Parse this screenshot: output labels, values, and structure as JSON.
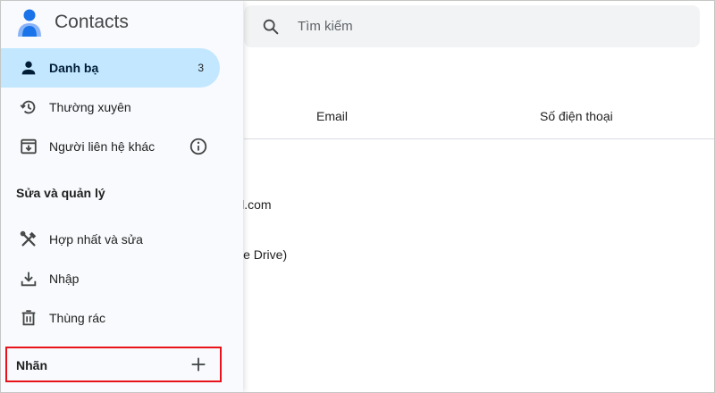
{
  "app": {
    "title": "Contacts"
  },
  "search": {
    "placeholder": "Tìm kiếm",
    "icon": "search-icon"
  },
  "table": {
    "columns": [
      "Email",
      "Số điện thoại"
    ],
    "rows": [
      {
        "fragment": "il.com"
      },
      {
        "fragment": "le Drive)"
      }
    ]
  },
  "sidebar": {
    "items": [
      {
        "label": "Danh bạ",
        "count": "3",
        "icon": "person-icon",
        "active": true
      },
      {
        "label": "Thường xuyên",
        "icon": "history-icon"
      },
      {
        "label": "Người liên hệ khác",
        "icon": "archive-download-icon",
        "info_icon": "info-icon"
      }
    ],
    "section_title": "Sửa và quản lý",
    "manage_items": [
      {
        "label": "Hợp nhất và sửa",
        "icon": "tools-icon"
      },
      {
        "label": "Nhập",
        "icon": "download-icon"
      },
      {
        "label": "Thùng rác",
        "icon": "trash-icon"
      }
    ],
    "labels": {
      "title": "Nhãn",
      "add_icon": "plus-icon"
    }
  },
  "colors": {
    "active_item_bg": "#c2e7ff",
    "sidebar_bg": "#f8fafd",
    "highlight_border": "#e8131a",
    "logo_blue": "#1a73e8",
    "logo_light": "#8ab4f8"
  }
}
